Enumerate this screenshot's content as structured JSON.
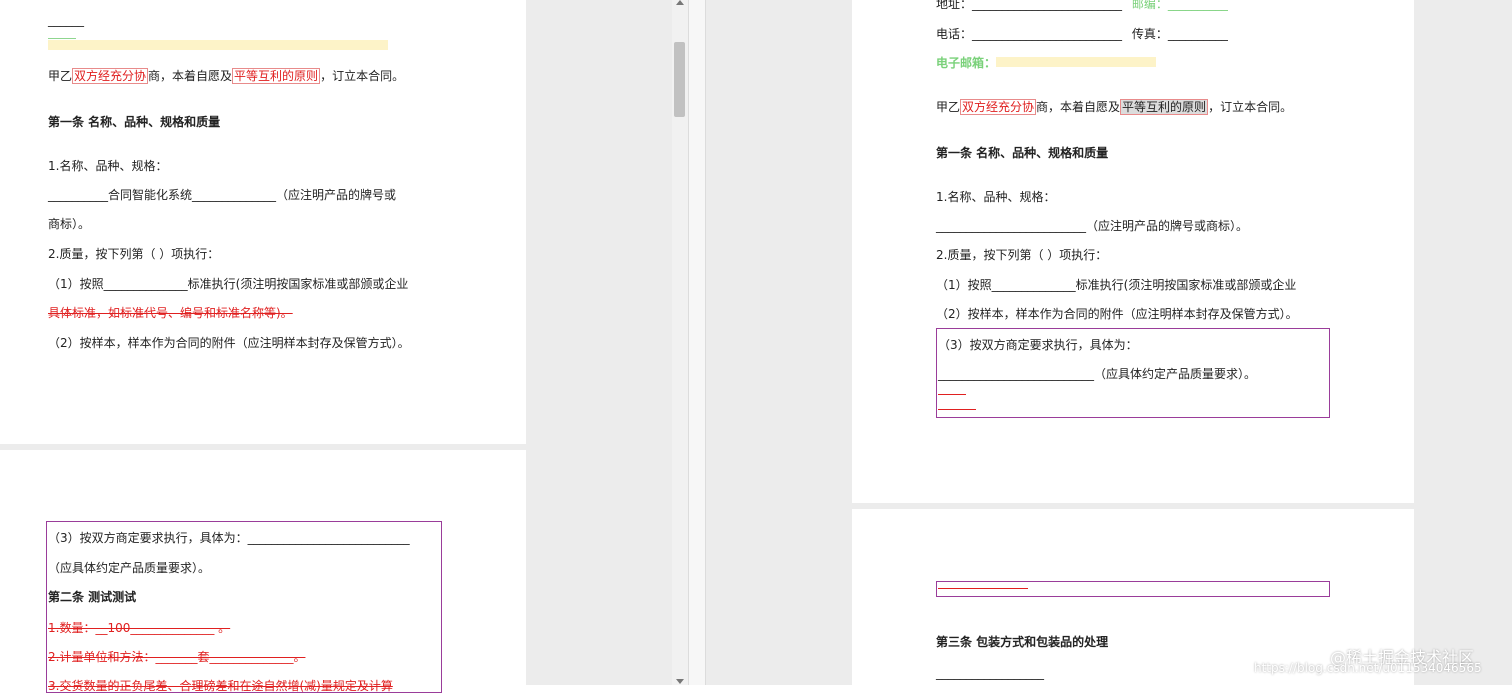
{
  "left": {
    "page1": {
      "blank_top": "______",
      "party_line": {
        "pre": "甲乙",
        "box1": "双方经充分协",
        "mid": "商，本着自愿及",
        "box2": "平等互利的原则",
        "post": "，订立本合同。"
      },
      "article1_heading": "第一条  名称、品种、规格和质量",
      "item1": "1.名称、品种、规格：",
      "product_line": "__________合同智能化系统______________（应注明产品的牌号或",
      "product_line2": "商标）。",
      "quality": "2.质量，按下列第（ ）项执行：",
      "q1": "（1）按照______________标准执行(须注明按国家标准或部颁或企业",
      "q1_strike": "具体标准，如标准代号、编号和标准名称等)。",
      "q2": "（2）按样本，样本作为合同的附件（应注明样本封存及保管方式）。"
    },
    "page2": {
      "q3": "（3）按双方商定要求执行，具体为：___________________________",
      "q3b": "（应具体约定产品质量要求）。",
      "article2_heading": "第二条  测试测试",
      "qty": "1.数量：__100______________  。",
      "unit": "2.计量单位和方法：_______套______________。",
      "partial": "3.交货数量的正负尾差、合理磅差和在途自然增(减)量规定及计算"
    }
  },
  "right": {
    "page1": {
      "address_label": "地址：",
      "address_blank": "_________________________",
      "postcode_label": "邮编：",
      "postcode_blank": "__________",
      "phone_label": "电话：",
      "phone_blank": "_________________________",
      "fax_label": "传真：",
      "fax_blank": "__________",
      "email_label": "电子邮箱：",
      "party_line": {
        "pre": "甲乙",
        "box1": "双方经充分协",
        "mid": "商，本着自愿及",
        "box2": "平等互利的原则",
        "post": "，订立本合同。"
      },
      "article1_heading": "第一条  名称、品种、规格和质量",
      "item1": "1.名称、品种、规格：",
      "product_line": "_________________________（应注明产品的牌号或商标）。",
      "quality": "2.质量，按下列第（ ）项执行：",
      "q1": "（1）按照______________标准执行(须注明按国家标准或部颁或企业",
      "q2": "（2）按样本，样本作为合同的附件（应注明样本封存及保管方式）。",
      "q3": "（3）按双方商定要求执行，具体为：",
      "q3b": "__________________________（应具体约定产品质量要求）。"
    },
    "page2": {
      "article3_heading": "第三条  包装方式和包装品的处理",
      "blank": "__________________"
    },
    "watermark": "@稀土掘金技术社区",
    "url": "https://blog.csdn.net/u011534046565"
  }
}
